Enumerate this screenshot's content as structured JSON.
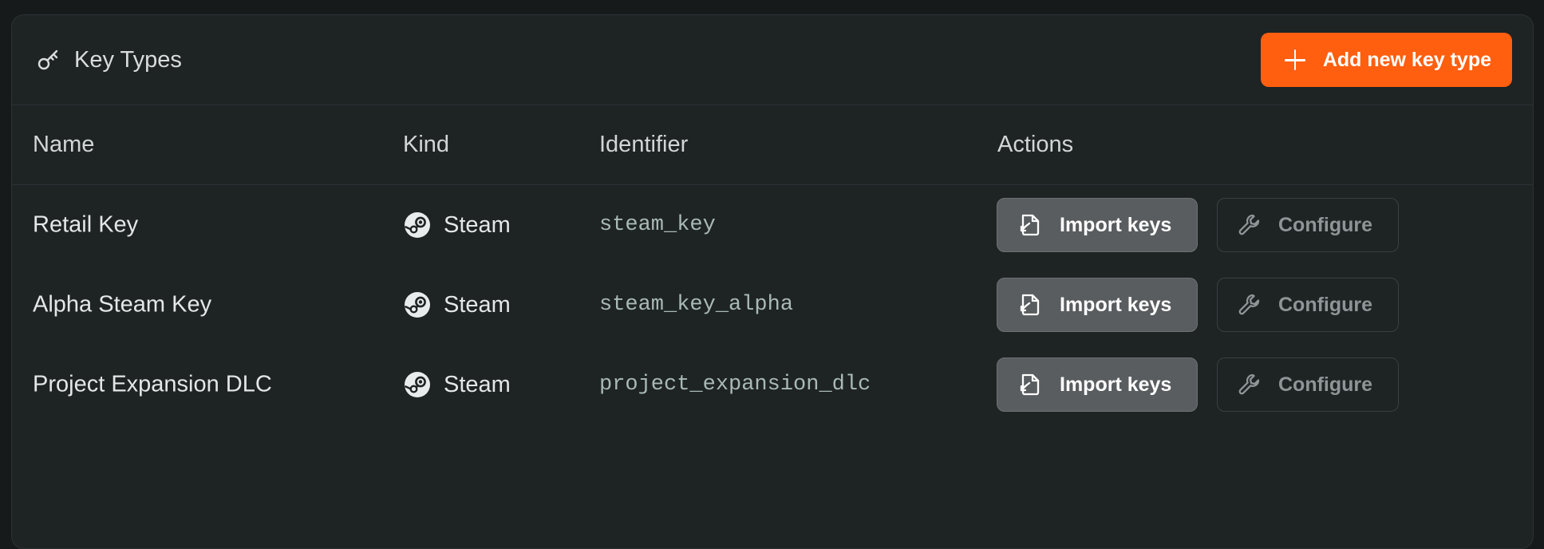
{
  "panel": {
    "title": "Key Types",
    "title_icon": "key-icon",
    "add_button_label": "Add new key type",
    "add_button_icon": "plus-icon",
    "accent_color": "#ff5f0f"
  },
  "table": {
    "headers": {
      "name": "Name",
      "kind": "Kind",
      "identifier": "Identifier",
      "actions": "Actions"
    },
    "rows": [
      {
        "name": "Retail Key",
        "kind": "Steam",
        "kind_icon": "steam-icon",
        "identifier": "steam_key",
        "import_label": "Import keys",
        "configure_label": "Configure"
      },
      {
        "name": "Alpha Steam Key",
        "kind": "Steam",
        "kind_icon": "steam-icon",
        "identifier": "steam_key_alpha",
        "import_label": "Import keys",
        "configure_label": "Configure"
      },
      {
        "name": "Project Expansion DLC",
        "kind": "Steam",
        "kind_icon": "steam-icon",
        "identifier": "project_expansion_dlc",
        "import_label": "Import keys",
        "configure_label": "Configure"
      }
    ]
  }
}
